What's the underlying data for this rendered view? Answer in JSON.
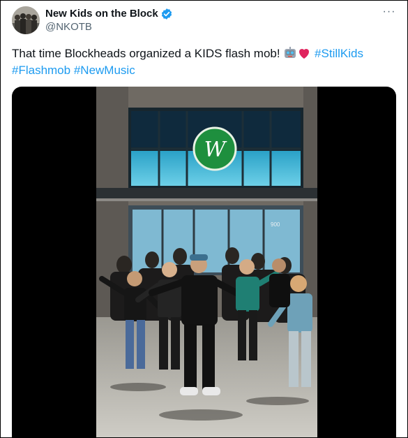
{
  "author": {
    "display_name": "New Kids on the Block",
    "handle": "@NKOTB",
    "verified_color": "#1d9bf0"
  },
  "tweet": {
    "text_prefix": "That time Blockheads organized a KIDS flash mob! ",
    "emojis": [
      "robot-face",
      "red-heart"
    ],
    "hashtags": [
      "#StillKids",
      "#Flashmob",
      "#NewMusic"
    ]
  },
  "media": {
    "type": "video",
    "scene": "flash mob dancing outside a building with a green W logo",
    "store_number": "900"
  },
  "menu": {
    "more_icon": "more-horizontal-icon",
    "label": "···"
  }
}
